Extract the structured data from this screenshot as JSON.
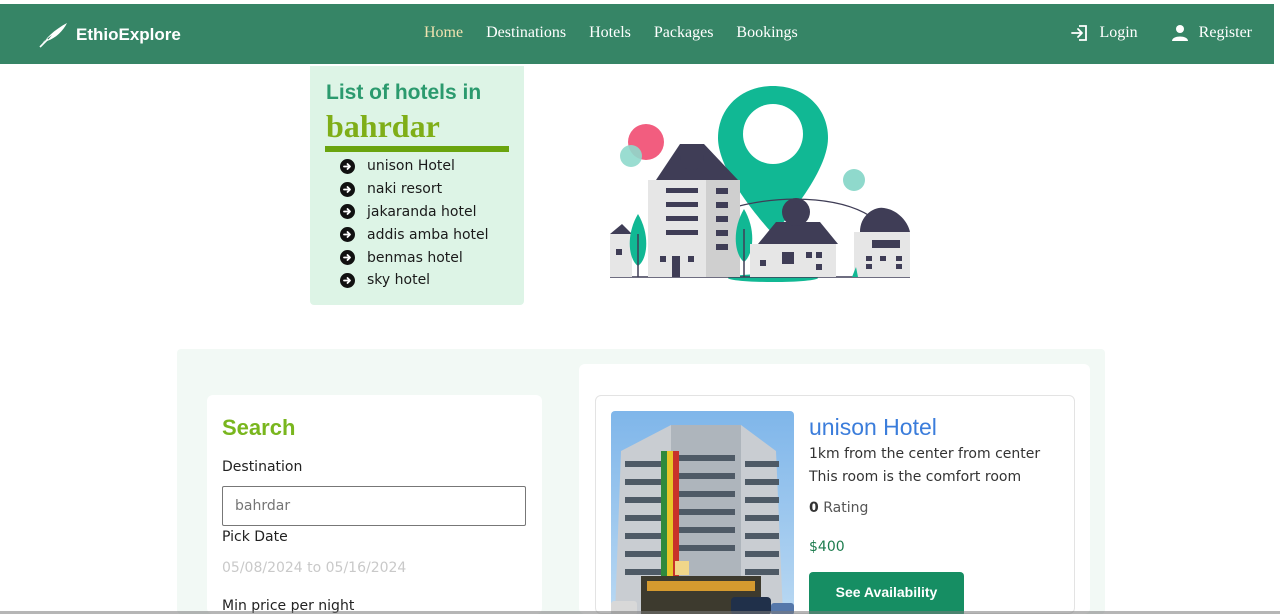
{
  "nav": {
    "brand": "EthioExplore",
    "links": [
      {
        "label": "Home",
        "active": true
      },
      {
        "label": "Destinations"
      },
      {
        "label": "Hotels"
      },
      {
        "label": "Packages"
      },
      {
        "label": "Bookings"
      }
    ],
    "login": "Login",
    "register": "Register",
    "bar_color": "#368566"
  },
  "hotel_list": {
    "title": "List of hotels in",
    "city": "bahrdar",
    "items": [
      "unison Hotel",
      "naki resort",
      "jakaranda hotel",
      "addis amba hotel",
      "benmas hotel",
      "sky hotel"
    ]
  },
  "search": {
    "title": "Search",
    "destination_label": "Destination",
    "destination_value": "bahrdar",
    "date_label": "Pick Date",
    "date_value": "05/08/2024 to 05/16/2024",
    "min_price_label": "Min price per night"
  },
  "result": {
    "name": "unison Hotel",
    "distance": "1km from the center from center",
    "description": "This room is the comfort room",
    "rating_value": "0",
    "rating_label": "Rating",
    "price": "$400",
    "button": "See Availability"
  },
  "icons": {
    "brand": "feather-icon",
    "login": "login-icon",
    "register": "user-icon",
    "list_bullet": "circle-arrow-right-icon"
  }
}
